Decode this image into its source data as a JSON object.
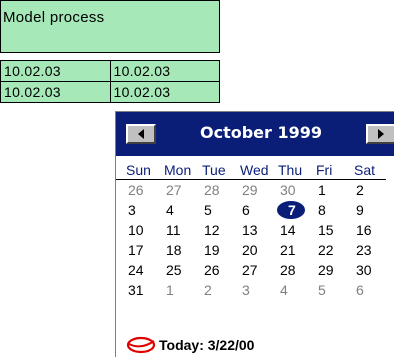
{
  "table": {
    "title": "Model process",
    "rows": [
      [
        "10.02.03",
        "10.02.03"
      ],
      [
        "10.02.03",
        "10.02.03"
      ]
    ]
  },
  "calendar": {
    "month_label": "October 1999",
    "day_names": [
      "Sun",
      "Mon",
      "Tue",
      "Wed",
      "Thu",
      "Fri",
      "Sat"
    ],
    "weeks": [
      [
        "26",
        "27",
        "28",
        "29",
        "30",
        "1",
        "2"
      ],
      [
        "3",
        "4",
        "5",
        "6",
        "7",
        "8",
        "9"
      ],
      [
        "10",
        "11",
        "12",
        "13",
        "14",
        "15",
        "16"
      ],
      [
        "17",
        "18",
        "19",
        "20",
        "21",
        "22",
        "23"
      ],
      [
        "24",
        "25",
        "26",
        "27",
        "28",
        "29",
        "30"
      ],
      [
        "31",
        "1",
        "2",
        "3",
        "4",
        "5",
        "6"
      ]
    ],
    "selected_day": "7",
    "today_label": "Today: 3/22/00",
    "colors": {
      "header": "#0a1e78",
      "today_marker": "#e00000",
      "cell_bg": "#a6e8b8"
    }
  }
}
